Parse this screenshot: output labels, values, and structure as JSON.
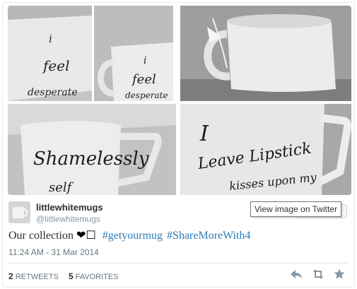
{
  "tweet": {
    "user": {
      "name": "littlewhitemugs",
      "screen_name": "@littlewhitemugs"
    },
    "text": {
      "body": "Our collection",
      "symbol": "☐",
      "hashtags": [
        "#getyourmug",
        "#ShareMoreWith4"
      ]
    },
    "timestamp": "11:24 AM - 31 Mar 2014",
    "stats": {
      "retweets_count": "2",
      "retweets_label": "RETWEETS",
      "favorites_count": "5",
      "favorites_label": "FAVORITES"
    },
    "tooltip": "View image on Twitter",
    "photos": {
      "p1_lines": [
        "i",
        "feel",
        "desperate"
      ],
      "p2_lines": [
        "i",
        "feel",
        "desperate"
      ],
      "p4_lines": [
        "Shamelessly",
        "self"
      ],
      "p5_lines": [
        "I",
        "Leave Lipstick",
        "kisses upon my"
      ]
    }
  },
  "icons": [
    "reply-icon",
    "retweet-icon",
    "favorite-icon",
    "heart-icon"
  ],
  "colors": {
    "hashtag": "#2b7bb9",
    "muted": "#8899a6",
    "text": "#292f33",
    "border": "#e1e8ed"
  }
}
